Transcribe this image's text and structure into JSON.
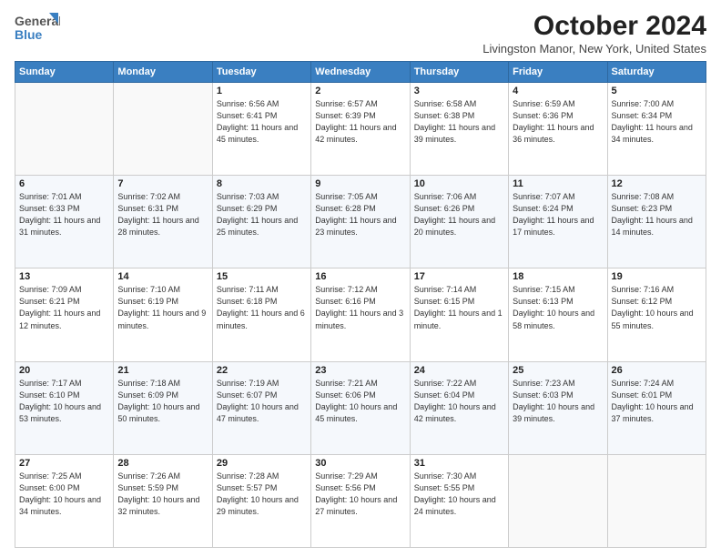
{
  "logo": {
    "line1": "General",
    "line2": "Blue"
  },
  "title": "October 2024",
  "subtitle": "Livingston Manor, New York, United States",
  "days_of_week": [
    "Sunday",
    "Monday",
    "Tuesday",
    "Wednesday",
    "Thursday",
    "Friday",
    "Saturday"
  ],
  "weeks": [
    [
      {
        "day": "",
        "info": ""
      },
      {
        "day": "",
        "info": ""
      },
      {
        "day": "1",
        "info": "Sunrise: 6:56 AM\nSunset: 6:41 PM\nDaylight: 11 hours and 45 minutes."
      },
      {
        "day": "2",
        "info": "Sunrise: 6:57 AM\nSunset: 6:39 PM\nDaylight: 11 hours and 42 minutes."
      },
      {
        "day": "3",
        "info": "Sunrise: 6:58 AM\nSunset: 6:38 PM\nDaylight: 11 hours and 39 minutes."
      },
      {
        "day": "4",
        "info": "Sunrise: 6:59 AM\nSunset: 6:36 PM\nDaylight: 11 hours and 36 minutes."
      },
      {
        "day": "5",
        "info": "Sunrise: 7:00 AM\nSunset: 6:34 PM\nDaylight: 11 hours and 34 minutes."
      }
    ],
    [
      {
        "day": "6",
        "info": "Sunrise: 7:01 AM\nSunset: 6:33 PM\nDaylight: 11 hours and 31 minutes."
      },
      {
        "day": "7",
        "info": "Sunrise: 7:02 AM\nSunset: 6:31 PM\nDaylight: 11 hours and 28 minutes."
      },
      {
        "day": "8",
        "info": "Sunrise: 7:03 AM\nSunset: 6:29 PM\nDaylight: 11 hours and 25 minutes."
      },
      {
        "day": "9",
        "info": "Sunrise: 7:05 AM\nSunset: 6:28 PM\nDaylight: 11 hours and 23 minutes."
      },
      {
        "day": "10",
        "info": "Sunrise: 7:06 AM\nSunset: 6:26 PM\nDaylight: 11 hours and 20 minutes."
      },
      {
        "day": "11",
        "info": "Sunrise: 7:07 AM\nSunset: 6:24 PM\nDaylight: 11 hours and 17 minutes."
      },
      {
        "day": "12",
        "info": "Sunrise: 7:08 AM\nSunset: 6:23 PM\nDaylight: 11 hours and 14 minutes."
      }
    ],
    [
      {
        "day": "13",
        "info": "Sunrise: 7:09 AM\nSunset: 6:21 PM\nDaylight: 11 hours and 12 minutes."
      },
      {
        "day": "14",
        "info": "Sunrise: 7:10 AM\nSunset: 6:19 PM\nDaylight: 11 hours and 9 minutes."
      },
      {
        "day": "15",
        "info": "Sunrise: 7:11 AM\nSunset: 6:18 PM\nDaylight: 11 hours and 6 minutes."
      },
      {
        "day": "16",
        "info": "Sunrise: 7:12 AM\nSunset: 6:16 PM\nDaylight: 11 hours and 3 minutes."
      },
      {
        "day": "17",
        "info": "Sunrise: 7:14 AM\nSunset: 6:15 PM\nDaylight: 11 hours and 1 minute."
      },
      {
        "day": "18",
        "info": "Sunrise: 7:15 AM\nSunset: 6:13 PM\nDaylight: 10 hours and 58 minutes."
      },
      {
        "day": "19",
        "info": "Sunrise: 7:16 AM\nSunset: 6:12 PM\nDaylight: 10 hours and 55 minutes."
      }
    ],
    [
      {
        "day": "20",
        "info": "Sunrise: 7:17 AM\nSunset: 6:10 PM\nDaylight: 10 hours and 53 minutes."
      },
      {
        "day": "21",
        "info": "Sunrise: 7:18 AM\nSunset: 6:09 PM\nDaylight: 10 hours and 50 minutes."
      },
      {
        "day": "22",
        "info": "Sunrise: 7:19 AM\nSunset: 6:07 PM\nDaylight: 10 hours and 47 minutes."
      },
      {
        "day": "23",
        "info": "Sunrise: 7:21 AM\nSunset: 6:06 PM\nDaylight: 10 hours and 45 minutes."
      },
      {
        "day": "24",
        "info": "Sunrise: 7:22 AM\nSunset: 6:04 PM\nDaylight: 10 hours and 42 minutes."
      },
      {
        "day": "25",
        "info": "Sunrise: 7:23 AM\nSunset: 6:03 PM\nDaylight: 10 hours and 39 minutes."
      },
      {
        "day": "26",
        "info": "Sunrise: 7:24 AM\nSunset: 6:01 PM\nDaylight: 10 hours and 37 minutes."
      }
    ],
    [
      {
        "day": "27",
        "info": "Sunrise: 7:25 AM\nSunset: 6:00 PM\nDaylight: 10 hours and 34 minutes."
      },
      {
        "day": "28",
        "info": "Sunrise: 7:26 AM\nSunset: 5:59 PM\nDaylight: 10 hours and 32 minutes."
      },
      {
        "day": "29",
        "info": "Sunrise: 7:28 AM\nSunset: 5:57 PM\nDaylight: 10 hours and 29 minutes."
      },
      {
        "day": "30",
        "info": "Sunrise: 7:29 AM\nSunset: 5:56 PM\nDaylight: 10 hours and 27 minutes."
      },
      {
        "day": "31",
        "info": "Sunrise: 7:30 AM\nSunset: 5:55 PM\nDaylight: 10 hours and 24 minutes."
      },
      {
        "day": "",
        "info": ""
      },
      {
        "day": "",
        "info": ""
      }
    ]
  ]
}
